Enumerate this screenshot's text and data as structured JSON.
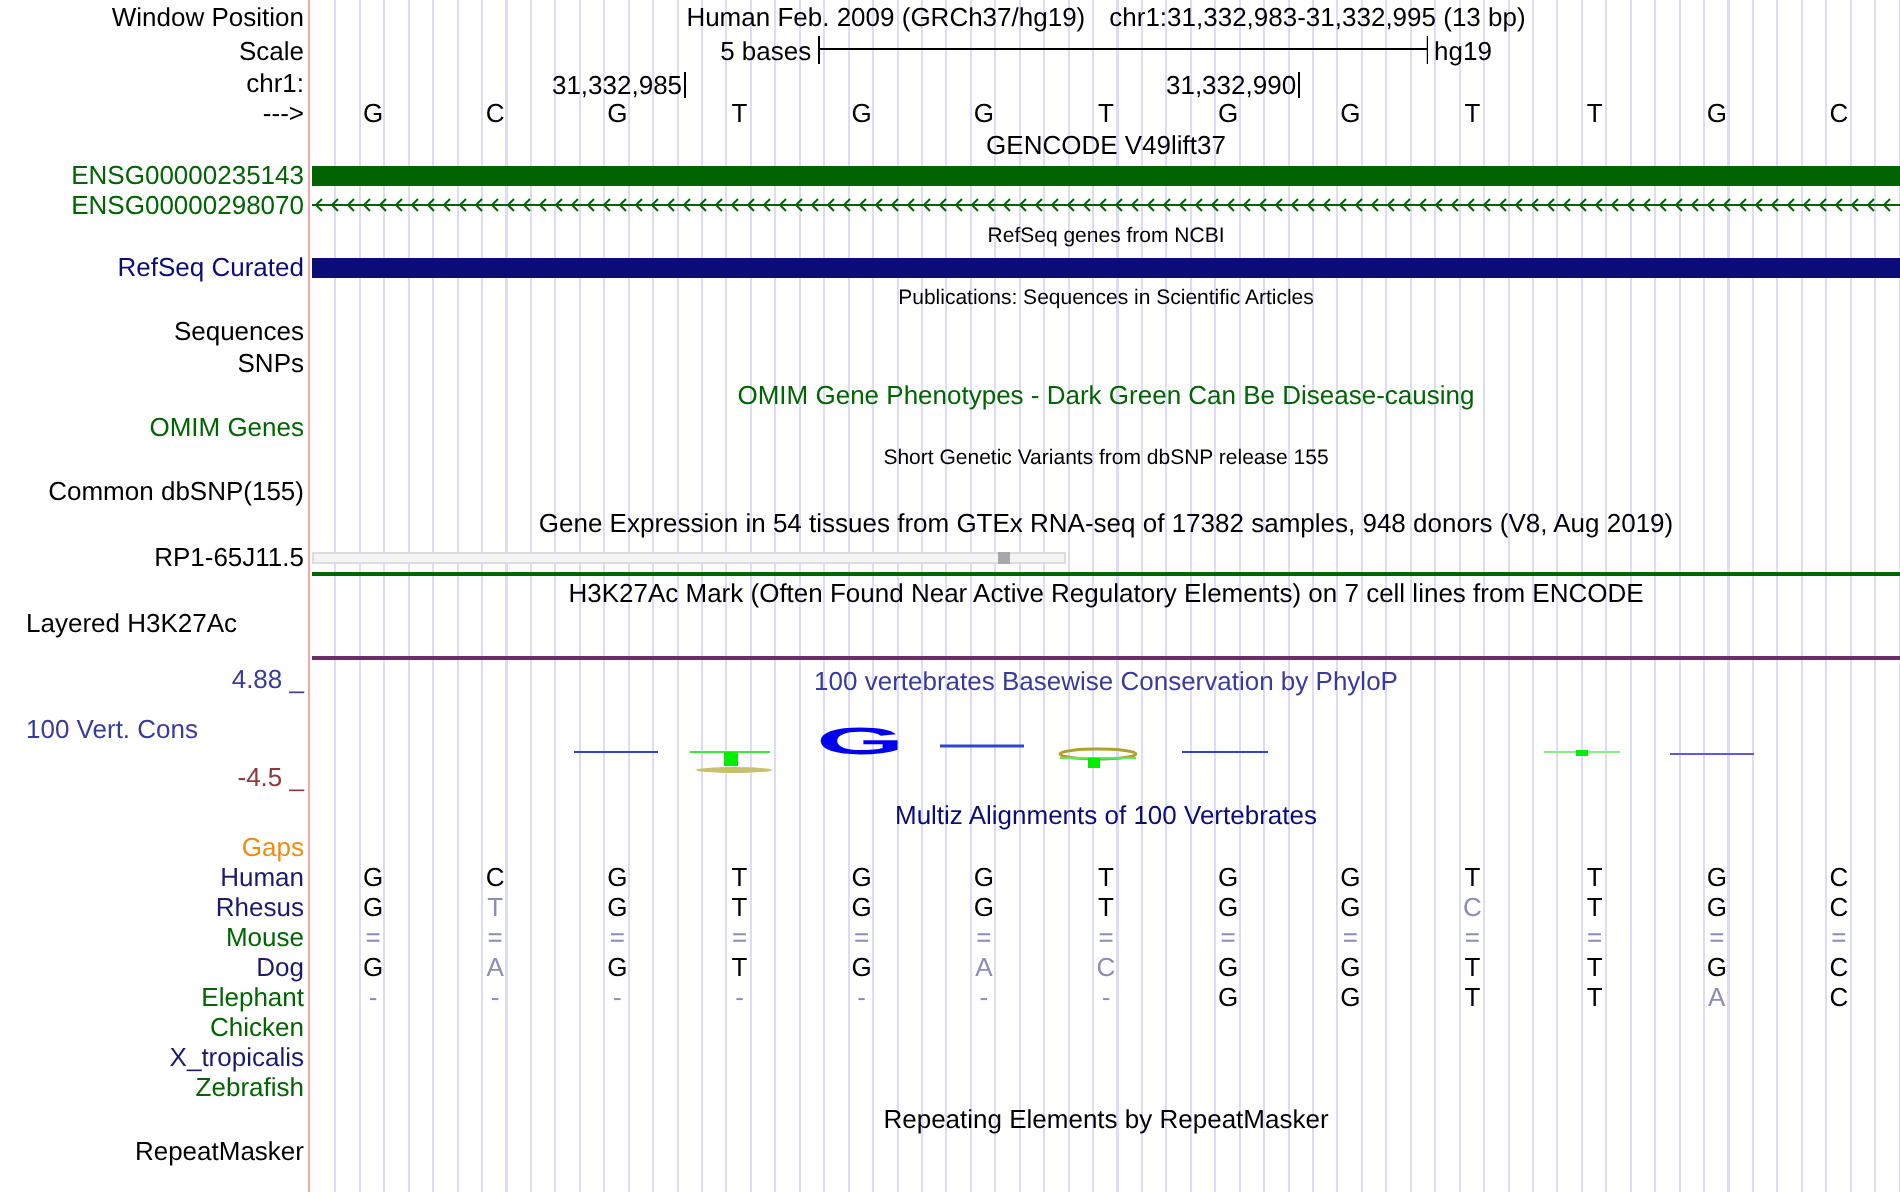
{
  "rows": [
    {
      "kind": "position",
      "label": "Window Position",
      "color": "#000000",
      "assembly": "Human Feb. 2009 (GRCh37/hg19)",
      "range": "chr1:31,332,983-31,332,995 (13 bp)"
    },
    {
      "kind": "scale",
      "label": "Scale",
      "color": "#000000",
      "text": "5 bases",
      "suffix": "hg19"
    },
    {
      "kind": "ticks",
      "label": "chr1:",
      "color": "#000000",
      "ticks": [
        "31,332,985",
        "31,332,990"
      ]
    },
    {
      "kind": "bases",
      "label": "--->",
      "color": "#000000",
      "bases": [
        "G",
        "C",
        "G",
        "T",
        "G",
        "G",
        "T",
        "G",
        "G",
        "T",
        "T",
        "G",
        "C"
      ]
    },
    {
      "kind": "title",
      "text": "GENCODE V49lift37",
      "color": "#000000"
    },
    {
      "kind": "gene_bar",
      "label": "ENSG00000235143",
      "color": "#006400"
    },
    {
      "kind": "gene_line",
      "label": "ENSG00000298070",
      "color": "#006400"
    },
    {
      "kind": "small_title",
      "text": "RefSeq genes from NCBI",
      "color": "#000000"
    },
    {
      "kind": "gene_bar",
      "label": "RefSeq Curated",
      "color": "#0c0c78"
    },
    {
      "kind": "small_title",
      "text": "Publications: Sequences in Scientific Articles",
      "color": "#000000"
    },
    {
      "kind": "label",
      "label": "Sequences",
      "color": "#000000"
    },
    {
      "kind": "label",
      "label": "SNPs",
      "color": "#000000"
    },
    {
      "kind": "title",
      "text": "OMIM Gene Phenotypes - Dark Green Can Be Disease-causing",
      "color": "#006400"
    },
    {
      "kind": "label",
      "label": "OMIM Genes",
      "color": "#006400"
    },
    {
      "kind": "small_title",
      "text": "Short Genetic Variants from dbSNP release 155",
      "color": "#000000"
    },
    {
      "kind": "label",
      "label": "Common dbSNP(155)",
      "color": "#000000"
    },
    {
      "kind": "title",
      "text": "Gene Expression in 54 tissues from GTEx RNA-seq of 17382 samples, 948 donors (V8, Aug 2019)",
      "color": "#000000"
    },
    {
      "kind": "expression",
      "label": "RP1-65J11.5",
      "color": "#000000"
    },
    {
      "kind": "title",
      "text": "H3K27Ac Mark (Often Found Near Active Regulatory Elements) on 7 cell lines from ENCODE",
      "color": "#000000"
    },
    {
      "kind": "layered",
      "label": "Layered H3K27Ac",
      "color": "#000000"
    },
    {
      "kind": "phylop",
      "title": "100 vertebrates Basewise Conservation by PhyloP",
      "max": "4.88 _",
      "label": "100 Vert. Cons",
      "min": "-4.5 _",
      "logo_letter": "G",
      "color": "#3a3a9a"
    },
    {
      "kind": "title",
      "text": "Multiz Alignments of 100 Vertebrates",
      "color": "#0c0c78"
    },
    {
      "kind": "label",
      "label": "Gaps",
      "color": "#ee8c10"
    },
    {
      "kind": "alignment",
      "label": "Human",
      "color": "#1a1a6e",
      "cells": [
        {
          "base": "G",
          "dimmed": false
        },
        {
          "base": "C",
          "dimmed": false
        },
        {
          "base": "G",
          "dimmed": false
        },
        {
          "base": "T",
          "dimmed": false
        },
        {
          "base": "G",
          "dimmed": false
        },
        {
          "base": "G",
          "dimmed": false
        },
        {
          "base": "T",
          "dimmed": false
        },
        {
          "base": "G",
          "dimmed": false
        },
        {
          "base": "G",
          "dimmed": false
        },
        {
          "base": "T",
          "dimmed": false
        },
        {
          "base": "T",
          "dimmed": false
        },
        {
          "base": "G",
          "dimmed": false
        },
        {
          "base": "C",
          "dimmed": false
        }
      ]
    },
    {
      "kind": "alignment",
      "label": "Rhesus",
      "color": "#1a1a6e",
      "cells": [
        {
          "base": "G",
          "dimmed": false
        },
        {
          "base": "T",
          "dimmed": true
        },
        {
          "base": "G",
          "dimmed": false
        },
        {
          "base": "T",
          "dimmed": false
        },
        {
          "base": "G",
          "dimmed": false
        },
        {
          "base": "G",
          "dimmed": false
        },
        {
          "base": "T",
          "dimmed": false
        },
        {
          "base": "G",
          "dimmed": false
        },
        {
          "base": "G",
          "dimmed": false
        },
        {
          "base": "C",
          "dimmed": true
        },
        {
          "base": "T",
          "dimmed": false
        },
        {
          "base": "G",
          "dimmed": false
        },
        {
          "base": "C",
          "dimmed": false
        }
      ]
    },
    {
      "kind": "alignment",
      "label": "Mouse",
      "color": "#006400",
      "cells": [
        {
          "base": "=",
          "dimmed": true
        },
        {
          "base": "=",
          "dimmed": true
        },
        {
          "base": "=",
          "dimmed": true
        },
        {
          "base": "=",
          "dimmed": true
        },
        {
          "base": "=",
          "dimmed": true
        },
        {
          "base": "=",
          "dimmed": true
        },
        {
          "base": "=",
          "dimmed": true
        },
        {
          "base": "=",
          "dimmed": true
        },
        {
          "base": "=",
          "dimmed": true
        },
        {
          "base": "=",
          "dimmed": true
        },
        {
          "base": "=",
          "dimmed": true
        },
        {
          "base": "=",
          "dimmed": true
        },
        {
          "base": "=",
          "dimmed": true
        }
      ]
    },
    {
      "kind": "alignment",
      "label": "Dog",
      "color": "#1a1a6e",
      "cells": [
        {
          "base": "G",
          "dimmed": false
        },
        {
          "base": "A",
          "dimmed": true
        },
        {
          "base": "G",
          "dimmed": false
        },
        {
          "base": "T",
          "dimmed": false
        },
        {
          "base": "G",
          "dimmed": false
        },
        {
          "base": "A",
          "dimmed": true
        },
        {
          "base": "C",
          "dimmed": true
        },
        {
          "base": "G",
          "dimmed": false
        },
        {
          "base": "G",
          "dimmed": false
        },
        {
          "base": "T",
          "dimmed": false
        },
        {
          "base": "T",
          "dimmed": false
        },
        {
          "base": "G",
          "dimmed": false
        },
        {
          "base": "C",
          "dimmed": false
        }
      ]
    },
    {
      "kind": "alignment",
      "label": "Elephant",
      "color": "#006400",
      "cells": [
        {
          "base": "-",
          "dimmed": true
        },
        {
          "base": "-",
          "dimmed": true
        },
        {
          "base": "-",
          "dimmed": true
        },
        {
          "base": "-",
          "dimmed": true
        },
        {
          "base": "-",
          "dimmed": true
        },
        {
          "base": "-",
          "dimmed": true
        },
        {
          "base": "-",
          "dimmed": true
        },
        {
          "base": "G",
          "dimmed": false
        },
        {
          "base": "G",
          "dimmed": false
        },
        {
          "base": "T",
          "dimmed": false
        },
        {
          "base": "T",
          "dimmed": false
        },
        {
          "base": "A",
          "dimmed": true
        },
        {
          "base": "C",
          "dimmed": false
        }
      ]
    },
    {
      "kind": "alignment",
      "label": "Chicken",
      "color": "#006400"
    },
    {
      "kind": "alignment",
      "label": "X_tropicalis",
      "color": "#1a1a6e"
    },
    {
      "kind": "alignment",
      "label": "Zebrafish",
      "color": "#006400"
    },
    {
      "kind": "title",
      "text": "Repeating Elements by RepeatMasker",
      "color": "#000000"
    },
    {
      "kind": "label",
      "label": "RepeatMasker",
      "color": "#000000"
    }
  ]
}
